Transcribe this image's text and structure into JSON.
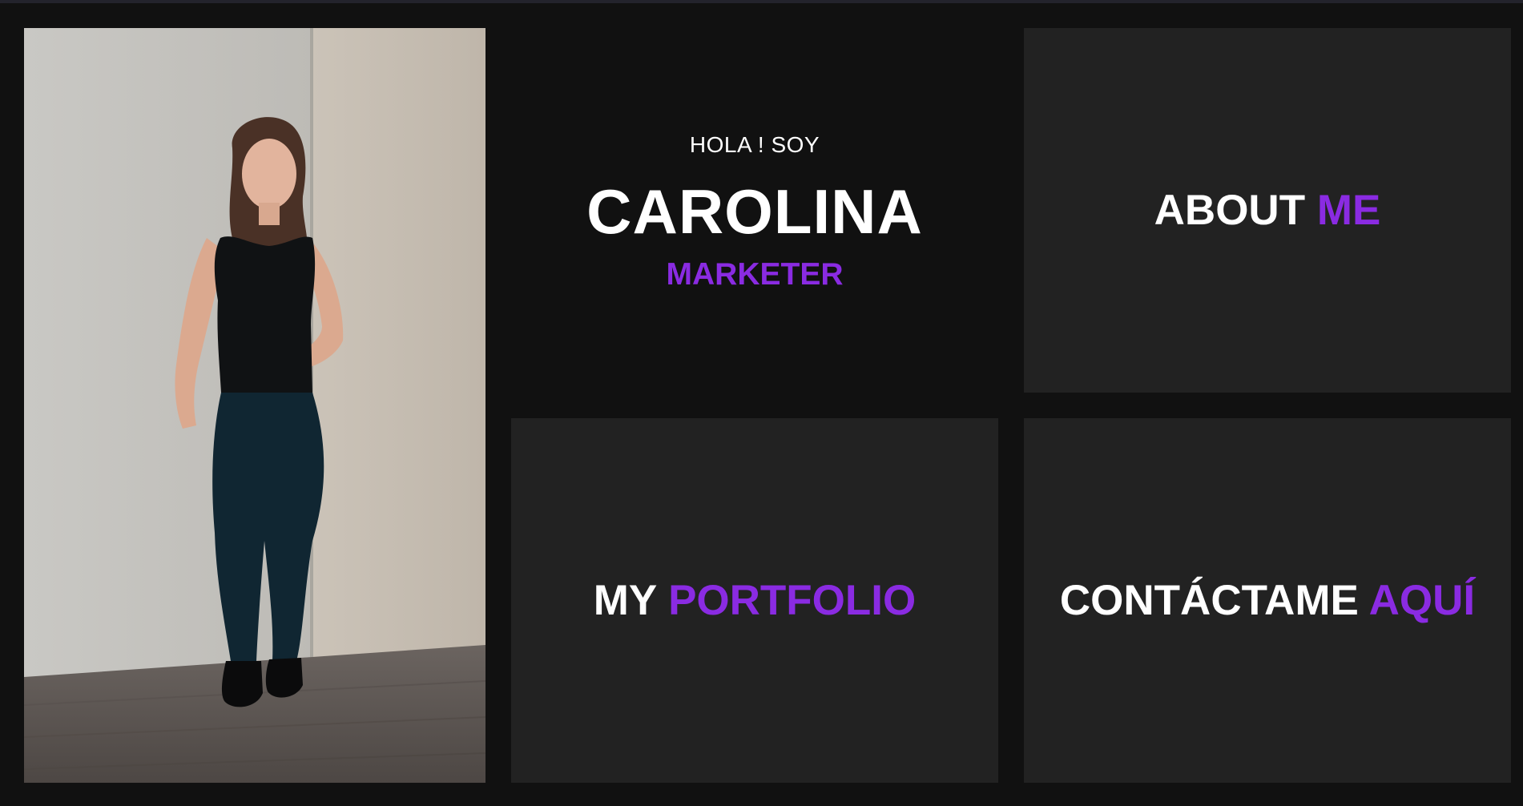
{
  "colors": {
    "background": "#111111",
    "tile": "#222222",
    "accent": "#8a2be2",
    "text": "#ffffff"
  },
  "hero": {
    "greeting": "HOLA ! SOY",
    "name": "CAROLINA",
    "role": "MARKETER"
  },
  "photo": {
    "icon": "profile-photo"
  },
  "tiles": {
    "about": {
      "word1": "ABOUT",
      "word2": "ME"
    },
    "portfolio": {
      "word1": "MY",
      "word2": "PORTFOLIO"
    },
    "contact": {
      "word1": "CONTÁCTAME",
      "word2": "AQUÍ"
    }
  }
}
